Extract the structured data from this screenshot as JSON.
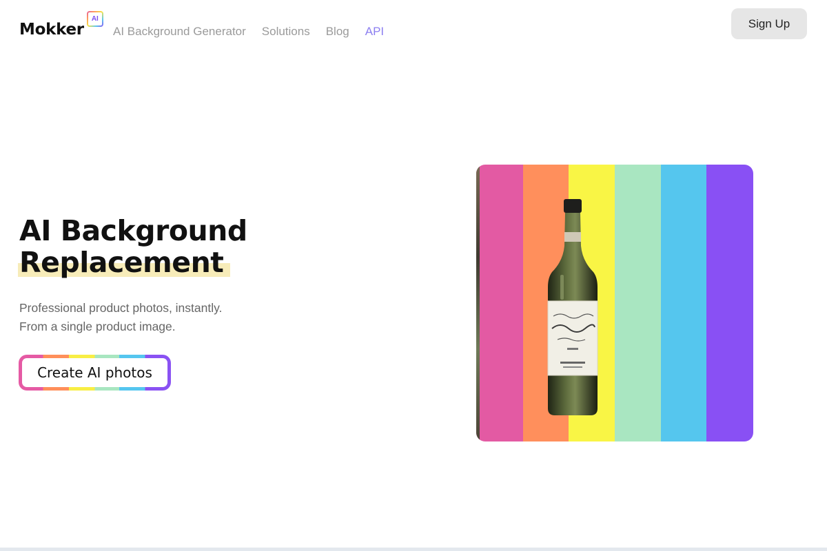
{
  "header": {
    "logo_text": "Mokker",
    "logo_badge": "AI",
    "nav": [
      "AI Background Generator",
      "Solutions",
      "Blog",
      "API"
    ],
    "signup_label": "Sign Up"
  },
  "hero": {
    "title_line1": "AI Background",
    "title_line2": "Replacement",
    "subtitle_line1": "Professional product photos, instantly.",
    "subtitle_line2": "From a single product image.",
    "cta_label": "Create AI photos"
  },
  "product_image": {
    "stripe_colors": [
      "#e35aa3",
      "#ff8f5c",
      "#f9f545",
      "#a9e6c1",
      "#55c6ee",
      "#8950f4"
    ],
    "subject": "wine bottle"
  },
  "colors": {
    "accent": "#8b7ef0",
    "highlight": "#f7ecb9"
  }
}
